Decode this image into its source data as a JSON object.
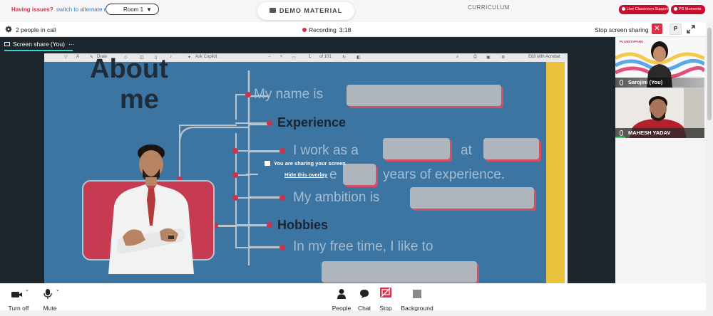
{
  "topbar": {
    "issues_label": "Having issues?",
    "alternate_room_link": "switch to alternate room",
    "room_selected": "Room 1",
    "demo_material_label": "DEMO MATERIAL",
    "curriculum_label": "CURRICULUM",
    "live_support_label": "Live Classroom Support",
    "moments_label": "PS Moments"
  },
  "call": {
    "people_count": "2 people in call",
    "recording_label": "Recording",
    "recording_time": "3:18",
    "stop_sharing_label": "Stop screen sharing",
    "close_glyph": "✕",
    "p_label": "P"
  },
  "share": {
    "tab_label": "Screen share (You)",
    "more_glyph": "···",
    "overlay_message": "You are sharing your screen",
    "hide_overlay_link": "Hide this overlay"
  },
  "pdf": {
    "toolbar_draw": "Draw",
    "toolbar_ask": "Ask Copilot",
    "toolbar_minus": "−",
    "toolbar_plus": "+",
    "toolbar_page": "of 101",
    "toolbar_edit": "Edit with Acrobat",
    "title_line1": "About",
    "title_line2": "me",
    "line_name": "My name is",
    "heading_experience": "Experience",
    "line_work_start": "I work as a",
    "line_work_at": "at",
    "line_exp_start": "e",
    "line_years": "years of experience.",
    "line_ambition": "My ambition is",
    "heading_hobbies": "Hobbies",
    "line_free_time": "In my free time, I like to"
  },
  "participants": [
    {
      "name": "Sarojini (You)",
      "logo": "PLANETSPARK"
    },
    {
      "name": "MAHESH YADAV"
    }
  ],
  "controls": {
    "turn_off": "Turn off",
    "mute": "Mute",
    "people": "People",
    "chat": "Chat",
    "stop": "Stop",
    "background": "Background"
  },
  "colors": {
    "accent_red": "#d8314a",
    "share_tab_underline": "#3bd4c4",
    "slide_background": "#3c74a2",
    "speaking_indicator": "#3bd46b"
  }
}
